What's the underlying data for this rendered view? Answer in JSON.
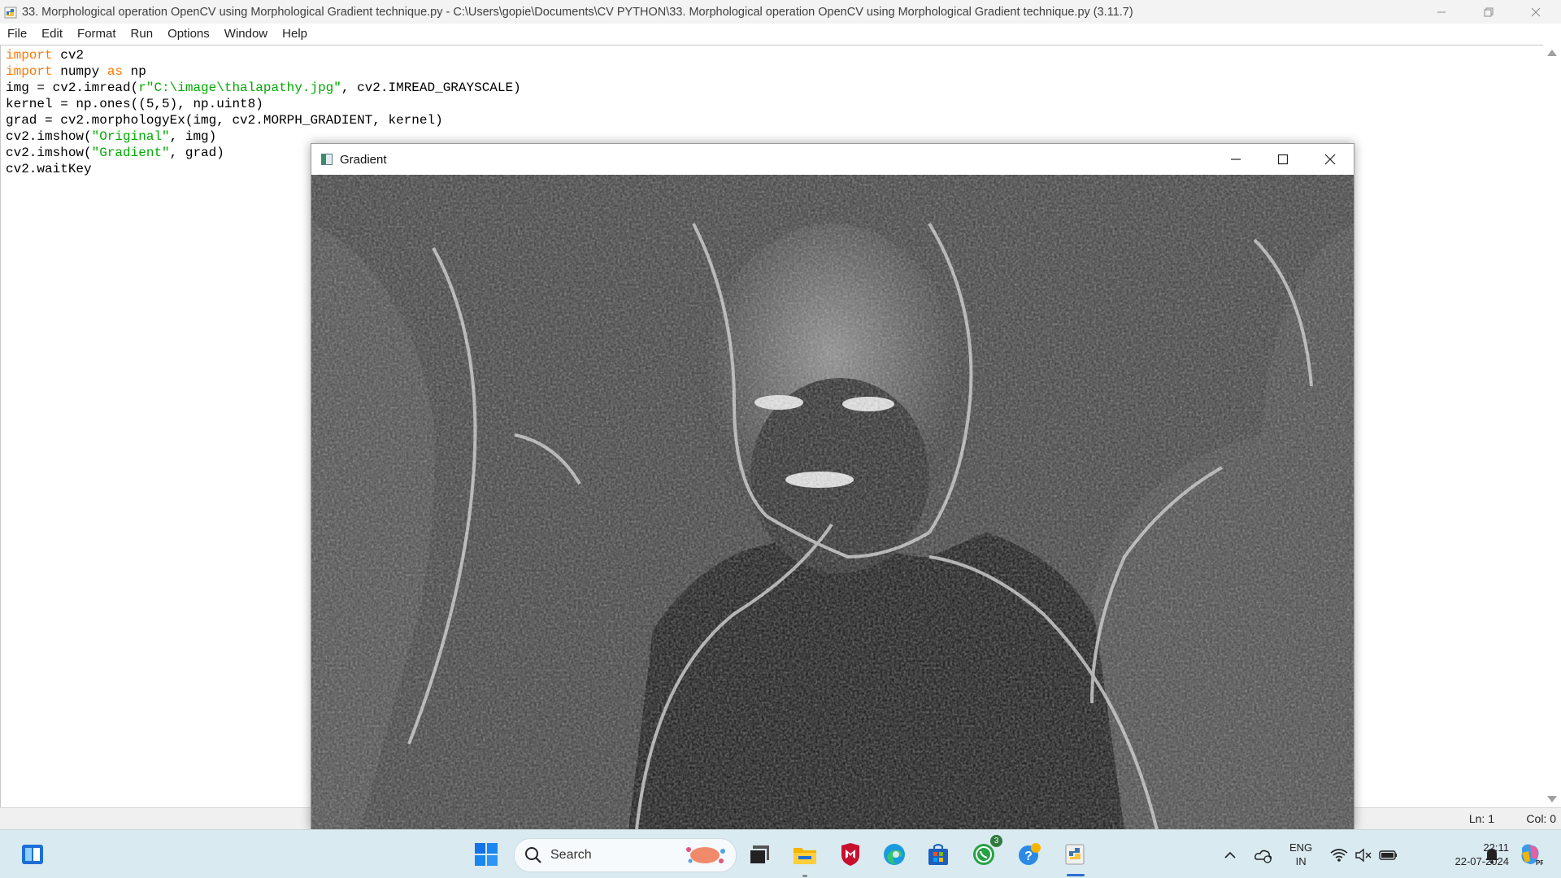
{
  "idle": {
    "title": "33. Morphological operation OpenCV using Morphological Gradient technique.py - C:\\Users\\gopie\\Documents\\CV PYTHON\\33. Morphological operation OpenCV using Morphological Gradient technique.py (3.11.7)",
    "menu": [
      "File",
      "Edit",
      "Format",
      "Run",
      "Options",
      "Window",
      "Help"
    ],
    "code": {
      "l1_kw": "import",
      "l1_rest": " cv2",
      "l2_kw1": "import",
      "l2_mid": " numpy ",
      "l2_kw2": "as",
      "l2_rest": " np",
      "l3_a": "img = cv2.imread(",
      "l3_str": "r\"C:\\image\\thalapathy.jpg\"",
      "l3_b": ", cv2.IMREAD_GRAYSCALE)",
      "l4": "kernel = np.ones((5,5), np.uint8)",
      "l5": "grad = cv2.morphologyEx(img, cv2.MORPH_GRADIENT, kernel)",
      "l6_a": "cv2.imshow(",
      "l6_str": "\"Original\"",
      "l6_b": ", img)",
      "l7_a": "cv2.imshow(",
      "l7_str": "\"Gradient\"",
      "l7_b": ", grad)",
      "l8": "cv2.waitKey"
    },
    "status": {
      "line": "Ln: 1",
      "col": "Col: 0"
    }
  },
  "cv_window": {
    "title": "Gradient"
  },
  "taskbar": {
    "search_label": "Search",
    "whatsapp_badge": "3",
    "lang_line1": "ENG",
    "lang_line2": "IN",
    "time": "22:11",
    "date": "22-07-2024"
  },
  "colors": {
    "keyword": "#ff7700",
    "string": "#00aa00",
    "taskbar": "#d9eaf1",
    "accent": "#2a6dd0"
  }
}
